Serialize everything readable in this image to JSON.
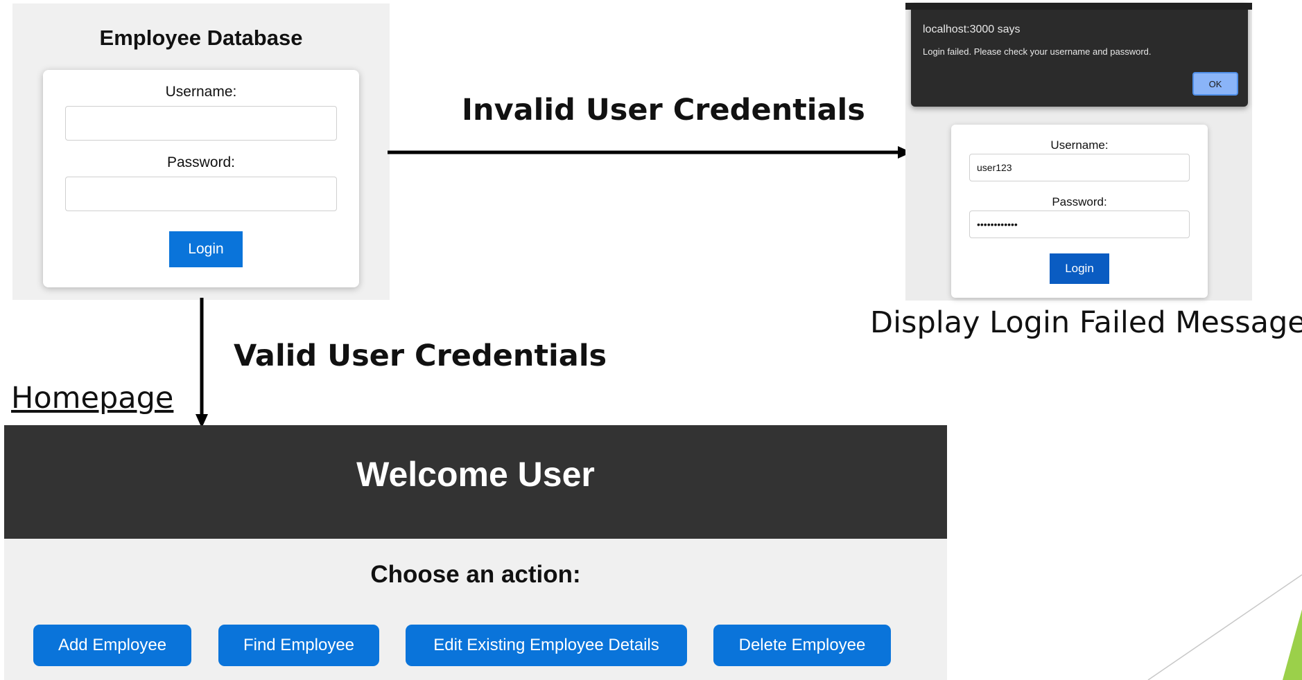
{
  "login_screen": {
    "title": "Employee Database",
    "username_label": "Username:",
    "username_value": "",
    "password_label": "Password:",
    "password_value": "",
    "login_button": "Login"
  },
  "flow": {
    "invalid_label": "Invalid User Credentials",
    "valid_label": "Valid User Credentials",
    "homepage_label": "Homepage",
    "failed_caption": "Display Login Failed Message"
  },
  "failed_screen": {
    "alert": {
      "origin": "localhost:3000 says",
      "message": "Login failed. Please check your username and password.",
      "ok_button": "OK"
    },
    "username_label": "Username:",
    "username_value": "user123",
    "password_label": "Password:",
    "password_value": "••••••••••••",
    "login_button": "Login"
  },
  "homepage": {
    "title": "Welcome User",
    "subtitle": "Choose an action:",
    "buttons": [
      "Add Employee",
      "Find Employee",
      "Edit Existing Employee Details",
      "Delete Employee"
    ]
  },
  "colors": {
    "primary_button": "#0a74da",
    "header_bg": "#333333",
    "panel_bg": "#f0f0f0",
    "alert_bg": "#2b2b2b",
    "deco_accent": "#9bd04a"
  }
}
